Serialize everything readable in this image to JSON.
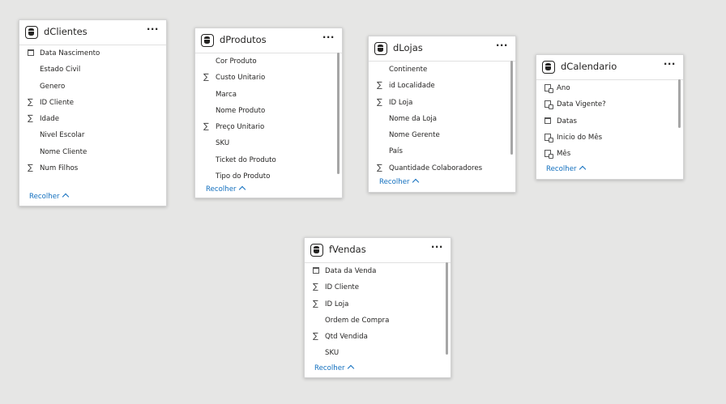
{
  "tables": {
    "dClientes": {
      "name": "dClientes",
      "fields": [
        {
          "label": "Data Nascimento",
          "icon": "calendar-icon"
        },
        {
          "label": "Estado Civil",
          "icon": ""
        },
        {
          "label": "Genero",
          "icon": ""
        },
        {
          "label": "ID Cliente",
          "icon": "sigma-icon"
        },
        {
          "label": "Idade",
          "icon": "sigma-icon"
        },
        {
          "label": "Nivel Escolar",
          "icon": ""
        },
        {
          "label": "Nome Cliente",
          "icon": ""
        },
        {
          "label": "Num Filhos",
          "icon": "sigma-icon"
        }
      ],
      "collapse": "Recolher"
    },
    "dProdutos": {
      "name": "dProdutos",
      "fields": [
        {
          "label": "Cor Produto",
          "icon": ""
        },
        {
          "label": "Custo Unitario",
          "icon": "sigma-icon"
        },
        {
          "label": "Marca",
          "icon": ""
        },
        {
          "label": "Nome Produto",
          "icon": ""
        },
        {
          "label": "Preço Unitario",
          "icon": "sigma-icon"
        },
        {
          "label": "SKU",
          "icon": ""
        },
        {
          "label": "Ticket do Produto",
          "icon": ""
        },
        {
          "label": "Tipo do Produto",
          "icon": ""
        }
      ],
      "collapse": "Recolher"
    },
    "dLojas": {
      "name": "dLojas",
      "fields": [
        {
          "label": "Continente",
          "icon": ""
        },
        {
          "label": "id Localidade",
          "icon": "sigma-icon"
        },
        {
          "label": "ID Loja",
          "icon": "sigma-icon"
        },
        {
          "label": "Nome da Loja",
          "icon": ""
        },
        {
          "label": "Nome Gerente",
          "icon": ""
        },
        {
          "label": "País",
          "icon": ""
        },
        {
          "label": "Quantidade Colaboradores",
          "icon": "sigma-icon"
        }
      ],
      "collapse": "Recolher"
    },
    "dCalendario": {
      "name": "dCalendario",
      "fields": [
        {
          "label": "Ano",
          "icon": "calculated-column-icon"
        },
        {
          "label": "Data Vigente?",
          "icon": "calculated-column-icon"
        },
        {
          "label": "Datas",
          "icon": "calendar-icon"
        },
        {
          "label": "Inicio do Mês",
          "icon": "calculated-column-icon"
        },
        {
          "label": "Mês",
          "icon": "calculated-column-icon"
        }
      ],
      "collapse": "Recolher"
    },
    "fVendas": {
      "name": "fVendas",
      "fields": [
        {
          "label": "Data da Venda",
          "icon": "calendar-icon"
        },
        {
          "label": "ID Cliente",
          "icon": "sigma-icon"
        },
        {
          "label": "ID Loja",
          "icon": "sigma-icon"
        },
        {
          "label": "Ordem de Compra",
          "icon": ""
        },
        {
          "label": "Qtd Vendida",
          "icon": "sigma-icon"
        },
        {
          "label": "SKU",
          "icon": ""
        }
      ],
      "collapse": "Recolher"
    }
  },
  "more_glyph": "···",
  "colors": {
    "background": "#e6e6e5",
    "link": "#106ebe",
    "card": "#ffffff"
  }
}
